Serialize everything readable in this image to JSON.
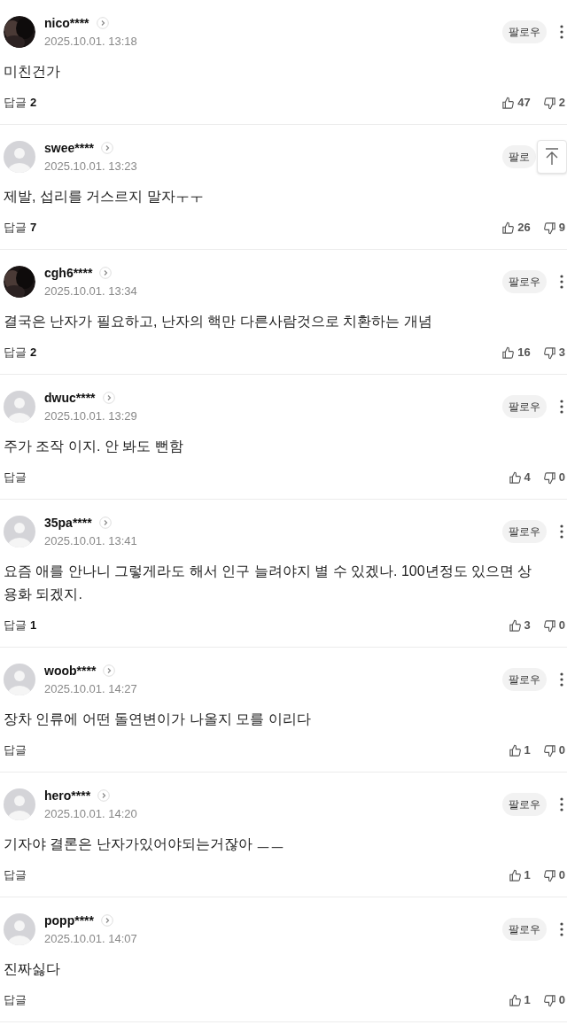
{
  "comments": [
    {
      "user": "nico****",
      "date": "2025.10.01. 13:18",
      "follow": "팔로우",
      "menu": true,
      "body": "미친건가",
      "reply_label": "답글",
      "reply_count": "2",
      "likes": "47",
      "dislikes": "2"
    },
    {
      "user": "swee****",
      "avatar": {
        "kind": "placeholder"
      },
      "date": "2025.10.01. 13:23",
      "follow": "팔로",
      "menu": false,
      "body": "제발, 섭리를 거스르지 말자ㅜㅜ",
      "reply_label": "답글",
      "reply_count": "7",
      "likes": "26",
      "dislikes": "9"
    },
    {
      "user": "cgh6****",
      "date": "2025.10.01. 13:34",
      "follow": "팔로우",
      "menu": true,
      "body": "결국은 난자가 필요하고, 난자의 핵만 다른사람것으로 치환하는 개념",
      "reply_label": "답글",
      "reply_count": "2",
      "likes": "16",
      "dislikes": "3"
    },
    {
      "user": "dwuc****",
      "avatar": {
        "kind": "placeholder"
      },
      "date": "2025.10.01. 13:29",
      "follow": "팔로우",
      "menu": true,
      "body": "주가 조작 이지. 안 봐도 뻔함",
      "reply_label": "답글",
      "likes": "4",
      "dislikes": "0"
    },
    {
      "user": "35pa****",
      "avatar": {
        "kind": "placeholder"
      },
      "date": "2025.10.01. 13:41",
      "follow": "팔로우",
      "menu": true,
      "body": "요즘 애를 안나니 그렇게라도 해서 인구 늘려야지 별 수 있겠나. 100년정도 있으면 상용화 되겠지.",
      "reply_label": "답글",
      "reply_count": "1",
      "likes": "3",
      "dislikes": "0"
    },
    {
      "user": "woob****",
      "avatar": {
        "kind": "placeholder"
      },
      "date": "2025.10.01. 14:27",
      "follow": "팔로우",
      "menu": true,
      "body": "장차 인류에 어떤 돌연변이가 나올지 모를 이리다",
      "reply_label": "답글",
      "likes": "1",
      "dislikes": "0"
    },
    {
      "user": "hero****",
      "avatar": {
        "kind": "placeholder"
      },
      "date": "2025.10.01. 14:20",
      "follow": "팔로우",
      "menu": true,
      "body": "기자야 결론은 난자가있어야되는거잖아 ㅡㅡ",
      "reply_label": "답글",
      "likes": "1",
      "dislikes": "0"
    },
    {
      "user": "popp****",
      "avatar": {
        "kind": "placeholder"
      },
      "date": "2025.10.01. 14:07",
      "follow": "팔로우",
      "menu": true,
      "body": "진짜싫다",
      "reply_label": "답글",
      "likes": "1",
      "dislikes": "0"
    }
  ],
  "scroll_top_button": true
}
